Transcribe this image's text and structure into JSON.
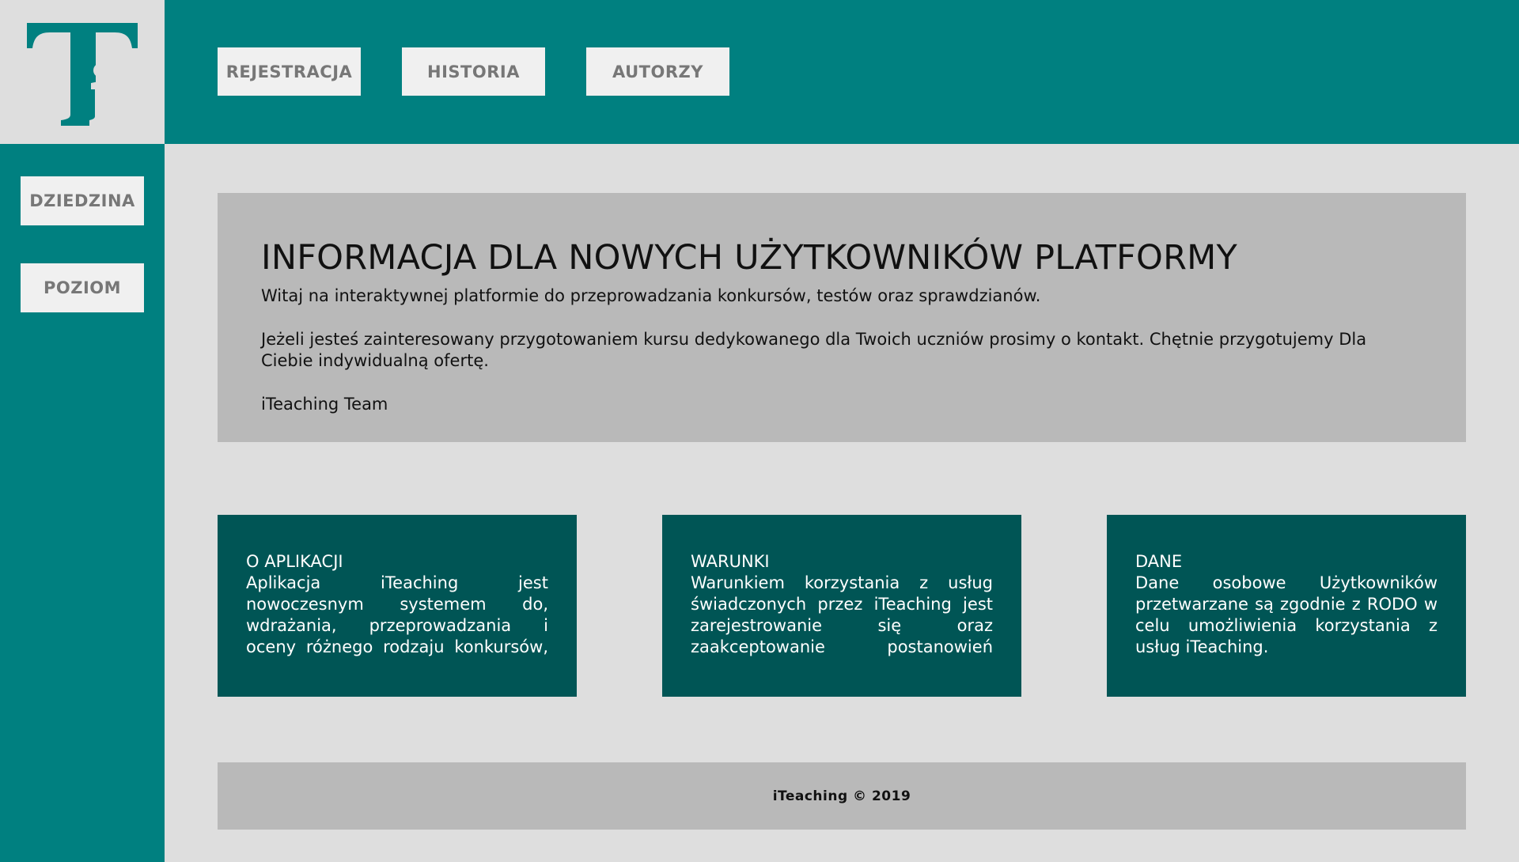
{
  "colors": {
    "teal": "#008080",
    "dark_teal": "#005555",
    "gray_panel": "#b9b9b9",
    "background": "#dedede",
    "button_bg": "#f0f0f0",
    "button_text": "#777777"
  },
  "logo": {
    "text": "Ti",
    "icon": "ti-logo-icon"
  },
  "header": {
    "nav": [
      {
        "label": "REJESTRACJA"
      },
      {
        "label": "HISTORIA"
      },
      {
        "label": "AUTORZY"
      }
    ]
  },
  "sidebar": {
    "items": [
      {
        "label": "DZIEDZINA"
      },
      {
        "label": "POZIOM"
      }
    ]
  },
  "info": {
    "title": "INFORMACJA DLA NOWYCH UŻYTKOWNIKÓW PLATFORMY",
    "paragraphs": [
      "Witaj na interaktywnej platformie do przeprowadzania konkursów, testów oraz sprawdzianów.",
      "Jeżeli jesteś zainteresowany przygotowaniem kursu dedykowanego dla Twoich uczniów prosimy o kontakt. Chętnie przygotujemy Dla Ciebie indywidualną ofertę.",
      "iTeaching Team"
    ]
  },
  "cards": [
    {
      "title": "O APLIKACJI",
      "body": "Aplikacja iTeaching jest nowoczesnym systemem do, wdrażania, przeprowadzania i oceny różnego rodzaju konkursów,"
    },
    {
      "title": "WARUNKI",
      "body": "Warunkiem korzystania z usług świadczonych przez iTeaching jest zarejestrowanie się oraz zaakceptowanie postanowień"
    },
    {
      "title": "DANE",
      "body": "Dane osobowe Użytkowników przetwarzane są zgodnie z RODO w celu umożliwienia korzystania z usług iTeaching."
    }
  ],
  "footer": {
    "text": "iTeaching © 2019"
  }
}
